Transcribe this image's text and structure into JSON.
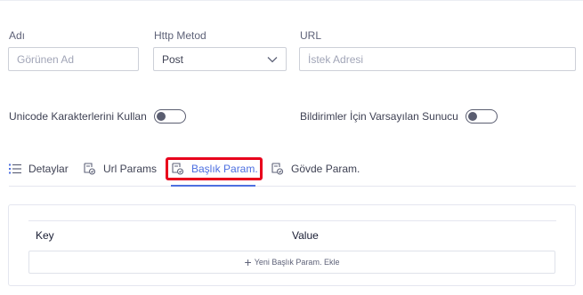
{
  "form": {
    "name": {
      "label": "Adı",
      "placeholder": "Görünen Ad",
      "value": ""
    },
    "method": {
      "label": "Http Metod",
      "value": "Post"
    },
    "url": {
      "label": "URL",
      "placeholder": "İstek Adresi",
      "value": ""
    },
    "unicode_toggle": {
      "label": "Unicode Karakterlerini Kullan",
      "on": false
    },
    "default_server_toggle": {
      "label": "Bildirimler İçin Varsayılan Sunucu",
      "on": false
    }
  },
  "tabs": [
    {
      "label": "Detaylar",
      "icon": "list-icon",
      "active": false
    },
    {
      "label": "Url Params",
      "icon": "params-icon",
      "active": false
    },
    {
      "label": "Başlık Param.",
      "icon": "params-icon",
      "active": true
    },
    {
      "label": "Gövde Param.",
      "icon": "params-icon",
      "active": false
    }
  ],
  "grid": {
    "columns": [
      "Key",
      "Value"
    ],
    "add_label": "Yeni Başlık Param. Ekle"
  },
  "colors": {
    "accent": "#4d6fe0",
    "highlight": "#e8001c"
  }
}
